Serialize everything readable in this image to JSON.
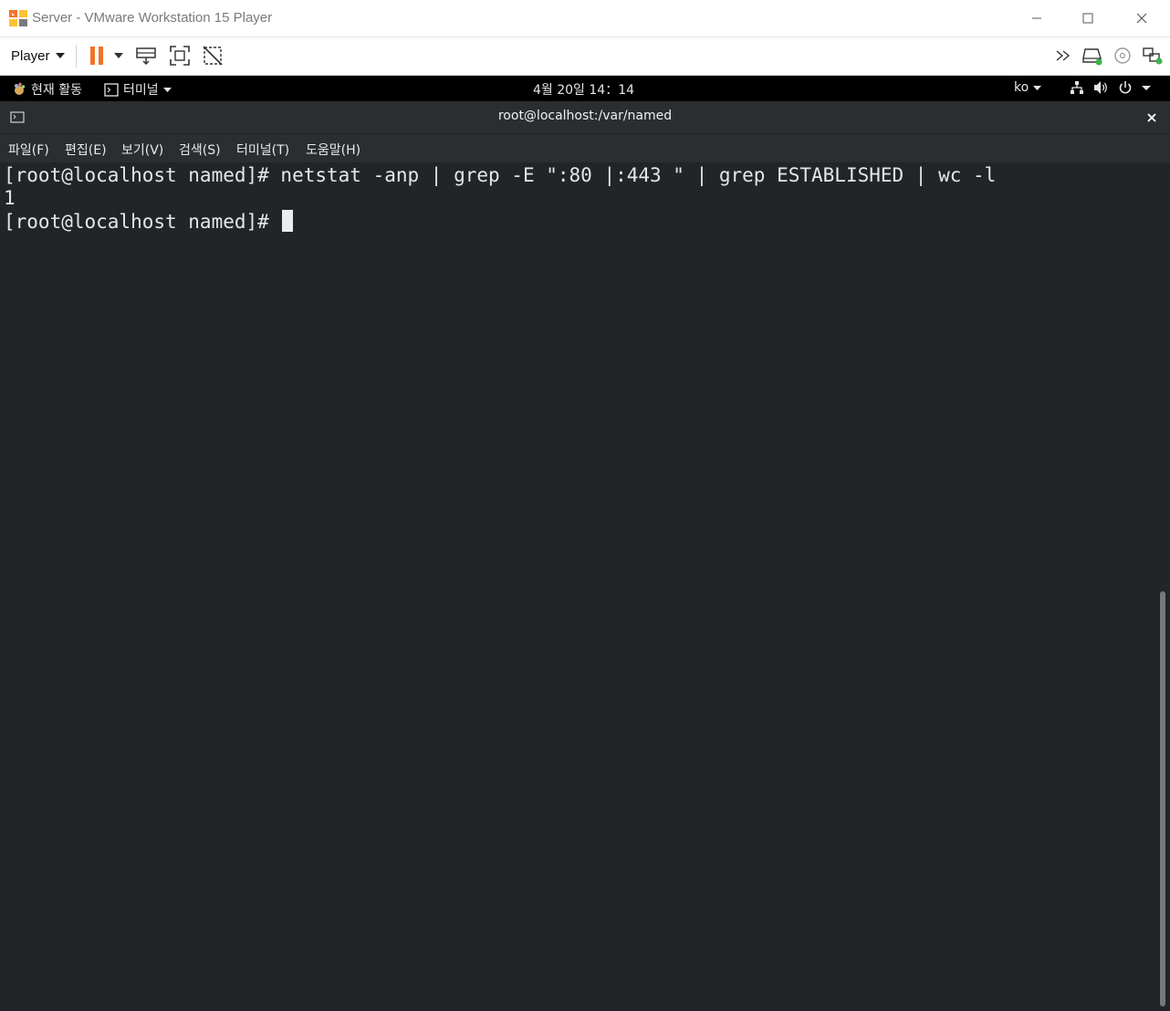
{
  "window": {
    "title": "Server - VMware Workstation 15 Player"
  },
  "toolbar": {
    "player_label": "Player",
    "left_icons": [
      "pause-icon",
      "send-ctrl-alt-del-icon",
      "fullscreen-icon",
      "unity-icon"
    ],
    "right_icons": [
      "more-chevrons-icon",
      "hard-disk-icon",
      "cd-dvd-icon",
      "network-adapter-icon"
    ]
  },
  "gnome_topbar": {
    "activities": "현재 활동",
    "app_menu": "터미널",
    "clock": "4월 20일  14：14",
    "input_method": "ko"
  },
  "terminal": {
    "title": "root@localhost:/var/named",
    "menu": [
      "파일(F)",
      "편집(E)",
      "보기(V)",
      "검색(S)",
      "터미널(T)",
      "도움말(H)"
    ],
    "lines": [
      "[root@localhost named]# netstat -anp | grep -E \":80 |:443 \" | grep ESTABLISHED | wc -l",
      "1",
      "[root@localhost named]# "
    ]
  },
  "colors": {
    "vmware_orange": "#f0742a",
    "terminal_bg": "#222528",
    "terminal_header": "#2b2e31",
    "gnome_bar": "#000000",
    "status_green": "#3fb34f"
  }
}
